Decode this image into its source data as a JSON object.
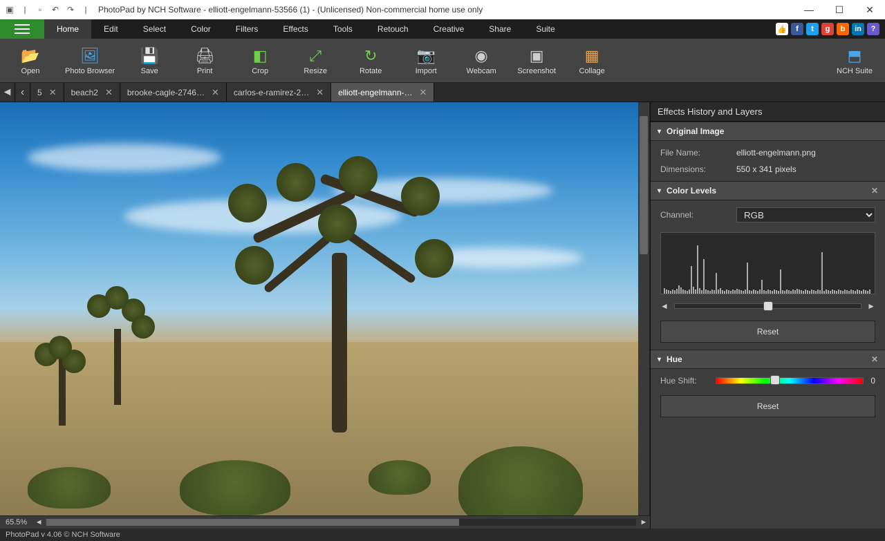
{
  "window": {
    "title": "PhotoPad by NCH Software - elliott-engelmann-53566 (1) - (Unlicensed) Non-commercial home use only"
  },
  "menus": [
    "Home",
    "Edit",
    "Select",
    "Color",
    "Filters",
    "Effects",
    "Tools",
    "Retouch",
    "Creative",
    "Share",
    "Suite"
  ],
  "active_menu": "Home",
  "ribbon": [
    {
      "id": "open",
      "label": "Open",
      "glyph": "📂",
      "cls": "ic-orange"
    },
    {
      "id": "photo-browser",
      "label": "Photo Browser",
      "glyph": "🖼",
      "cls": "ic-blue"
    },
    {
      "id": "save",
      "label": "Save",
      "glyph": "💾",
      "cls": "ic-blue"
    },
    {
      "id": "print",
      "label": "Print",
      "glyph": "🖨",
      "cls": "ic-gray"
    },
    {
      "id": "crop",
      "label": "Crop",
      "glyph": "◧",
      "cls": "ic-green"
    },
    {
      "id": "resize",
      "label": "Resize",
      "glyph": "⤢",
      "cls": "ic-green"
    },
    {
      "id": "rotate",
      "label": "Rotate",
      "glyph": "↻",
      "cls": "ic-green"
    },
    {
      "id": "import",
      "label": "Import",
      "glyph": "📷",
      "cls": "ic-gray"
    },
    {
      "id": "webcam",
      "label": "Webcam",
      "glyph": "◉",
      "cls": "ic-gray"
    },
    {
      "id": "screenshot",
      "label": "Screenshot",
      "glyph": "▣",
      "cls": "ic-gray"
    },
    {
      "id": "collage",
      "label": "Collage",
      "glyph": "▦",
      "cls": "ic-orange"
    },
    {
      "id": "nch-suite",
      "label": "NCH Suite",
      "glyph": "⬒",
      "cls": "ic-blue",
      "right": true
    }
  ],
  "tabs": [
    {
      "label": "5",
      "active": false
    },
    {
      "label": "beach2",
      "active": false
    },
    {
      "label": "brooke-cagle-2746…",
      "active": false
    },
    {
      "label": "carlos-e-ramirez-2…",
      "active": false
    },
    {
      "label": "elliott-engelmann-…",
      "active": true
    }
  ],
  "zoom": "65.5%",
  "side_panel": {
    "title": "Effects History and Layers",
    "original": {
      "header": "Original Image",
      "file_label": "File Name:",
      "file_value": "elliott-engelmann.png",
      "dim_label": "Dimensions:",
      "dim_value": "550 x 341 pixels"
    },
    "levels": {
      "header": "Color Levels",
      "channel_label": "Channel:",
      "channel_value": "RGB",
      "reset": "Reset"
    },
    "hue": {
      "header": "Hue",
      "shift_label": "Hue Shift:",
      "reset": "Reset"
    }
  },
  "statusbar": "PhotoPad v 4.06 © NCH Software"
}
